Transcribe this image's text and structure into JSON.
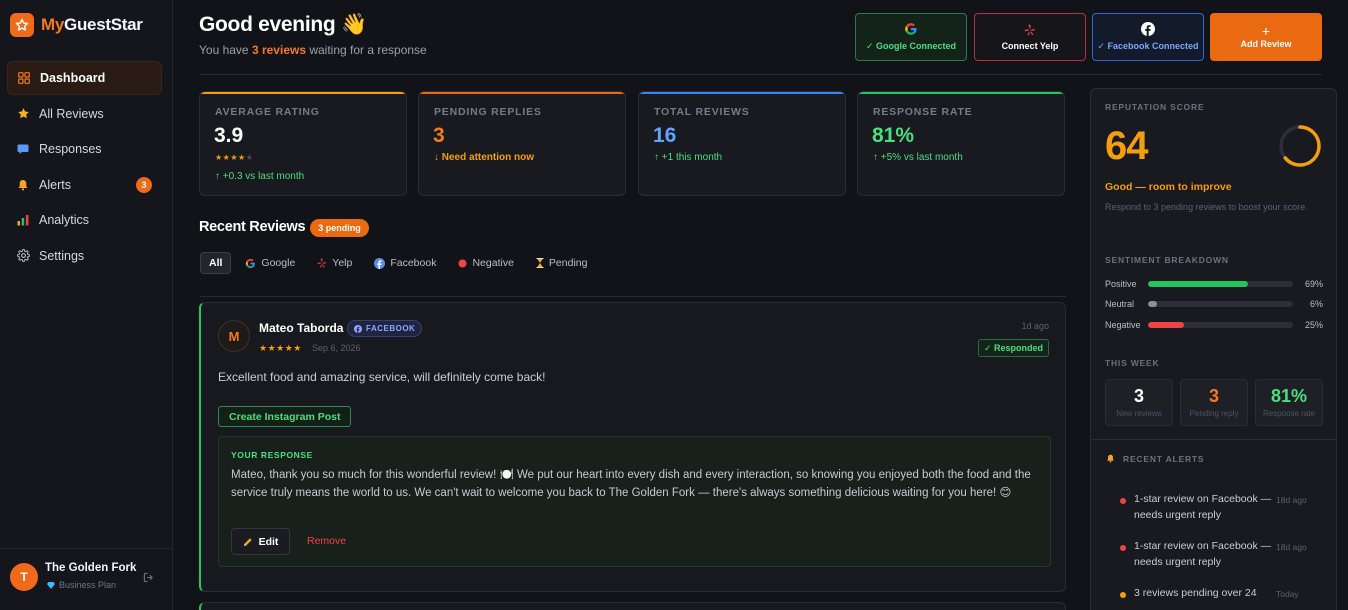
{
  "app": {
    "brand_prefix": "My",
    "brand_suffix": "GuestStar"
  },
  "sidebar": {
    "items": [
      {
        "label": "Dashboard",
        "icon": "grid-icon",
        "active": true
      },
      {
        "label": "All Reviews",
        "icon": "star-icon"
      },
      {
        "label": "Responses",
        "icon": "chat-icon"
      },
      {
        "label": "Alerts",
        "icon": "bell-icon",
        "badge": "3"
      },
      {
        "label": "Analytics",
        "icon": "bar-chart-icon"
      },
      {
        "label": "Settings",
        "icon": "gear-icon"
      }
    ],
    "footer": {
      "avatar_letter": "T",
      "business_name": "The Golden Fork",
      "plan": "Business Plan"
    }
  },
  "header": {
    "greeting": "Good evening 👋",
    "subtitle_prefix": "You have ",
    "subtitle_highlight": "3 reviews",
    "subtitle_suffix": " waiting for a response",
    "buttons": {
      "google": "✓ Google Connected",
      "yelp": "Connect Yelp",
      "facebook": "✓ Facebook Connected",
      "add": "Add Review",
      "add_symbol": "+"
    }
  },
  "stats": [
    {
      "label": "AVERAGE RATING",
      "value": "3.9",
      "stars_filled": "★★★★",
      "stars_empty": "★",
      "note": "↑ +0.3 vs last month",
      "accent": "#f59e0b",
      "value_color": "#ffffff",
      "note_color": "#4ade80"
    },
    {
      "label": "PENDING REPLIES",
      "value": "3",
      "note": "↓ Need attention now",
      "accent": "#ea6a12",
      "value_color": "#f47a20",
      "note_color": "#f59e0b"
    },
    {
      "label": "TOTAL REVIEWS",
      "value": "16",
      "note": "↑ +1 this month",
      "accent": "#3b82f6",
      "value_color": "#60a5fa",
      "note_color": "#4ade80"
    },
    {
      "label": "RESPONSE RATE",
      "value": "81%",
      "note": "↑ +5% vs last month",
      "accent": "#22c55e",
      "value_color": "#4ade80",
      "note_color": "#4ade80"
    }
  ],
  "recent_reviews": {
    "title": "Recent Reviews",
    "badge": "3 pending",
    "filters": [
      {
        "label": "All",
        "icon": "",
        "active": true
      },
      {
        "label": "Google",
        "icon": "google-icon"
      },
      {
        "label": "Yelp",
        "icon": "yelp-icon"
      },
      {
        "label": "Facebook",
        "icon": "facebook-icon"
      },
      {
        "label": "Negative",
        "icon": "red-dot-icon"
      },
      {
        "label": "Pending",
        "icon": "hourglass-icon"
      }
    ],
    "reviews": [
      {
        "avatar_letter": "M",
        "name": "Mateo Taborda",
        "platform": "FACEBOOK",
        "stars": "★★★★★",
        "date": "Sep 6, 2026",
        "ago": "1d ago",
        "status": "✓ Responded",
        "text": "Excellent food and amazing service, will definitely come back!",
        "action": "Create Instagram Post",
        "response_label": "YOUR RESPONSE",
        "response_text": "Mateo, thank you so much for this wonderful review! 🍽️ We put our heart into every dish and every interaction, so knowing you enjoyed both the food and the service truly means the world to us. We can't wait to welcome you back to The Golden Fork — there's always something delicious waiting for you here! 😊",
        "edit_label": "Edit",
        "remove_label": "Remove"
      }
    ]
  },
  "panel": {
    "reputation_label": "REPUTATION SCORE",
    "reputation_score": "64",
    "reputation_fraction": 0.64,
    "reputation_status": "Good — room to improve",
    "reputation_tip": "Respond to 3 pending reviews to boost your score.",
    "sentiment_label": "SENTIMENT BREAKDOWN",
    "sentiment": [
      {
        "name": "Positive",
        "pct": "69%",
        "fraction": 0.69,
        "color": "#22c55e"
      },
      {
        "name": "Neutral",
        "pct": "6%",
        "fraction": 0.06,
        "color": "#8a8f9c"
      },
      {
        "name": "Negative",
        "pct": "25%",
        "fraction": 0.25,
        "color": "#ef4444"
      }
    ],
    "week_label": "THIS WEEK",
    "week": [
      {
        "value": "3",
        "label": "New reviews",
        "color": "#ffffff"
      },
      {
        "value": "3",
        "label": "Pending reply",
        "color": "#f47a20"
      },
      {
        "value": "81%",
        "label": "Response rate",
        "color": "#4ade80"
      }
    ],
    "alerts_label": "RECENT ALERTS",
    "alerts": [
      {
        "text": "1-star review on Facebook — needs urgent reply",
        "ago": "18d ago",
        "color": "#ef4444"
      },
      {
        "text": "1-star review on Facebook — needs urgent reply",
        "ago": "18d ago",
        "color": "#ef4444"
      },
      {
        "text": "3 reviews pending over 24",
        "ago": "Today",
        "color": "#f59e0b"
      }
    ]
  }
}
